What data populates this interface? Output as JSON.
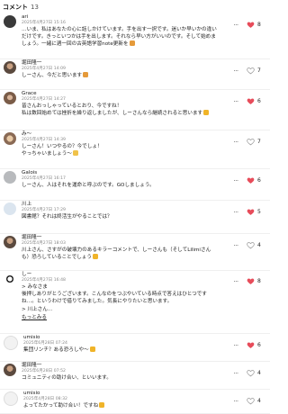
{
  "header": {
    "title": "コメント",
    "count": "13"
  },
  "colors": {
    "liked": "#e74c5a",
    "unliked": "#999999"
  },
  "comments": [
    {
      "author": "ari",
      "date": "2025年4月27日 15:16",
      "text": "…いま、私はあなたの心に話しかけています。手を出す一択です。迷いか早いかの違いだけです。きっといつかは手を出します。それなら早い方がいいのです。そして始めましょう。一緒に週一回の古英語学習note更新を",
      "emoji": "book",
      "likes": "8",
      "liked": true
    },
    {
      "author": "堀田隆一",
      "date": "2025年4月27日 14:09",
      "text": "しーさん、今だと思います",
      "emoji": "book",
      "likes": "7",
      "liked": false
    },
    {
      "author": "Grace",
      "date": "2025年4月27日 14:27",
      "text": "皆さんおっしゃっているとおり、今ですね！\n私は数回始めては挫折を繰り返しましたが、しーさんなら継続されると思います",
      "emoji": "smile",
      "likes": "6",
      "liked": true
    },
    {
      "author": "み〜",
      "date": "2025年4月27日 14:39",
      "text": "しーさん！いつやるの？今でしょ！\nやっちゃいましょう〜",
      "emoji": "hands",
      "likes": "7",
      "liked": false
    },
    {
      "author": "Galois",
      "date": "2025年4月27日 16:17",
      "text": "しーさん、人はそれを運命と呼ぶのです。GOしましょう。",
      "emoji": "",
      "likes": "6",
      "liked": true
    },
    {
      "author": "川上",
      "date": "2025年4月27日 17:29",
      "text": "図書館？それは終活生がやることでは？",
      "emoji": "",
      "likes": "5",
      "liked": true
    },
    {
      "author": "堀田隆一",
      "date": "2025年4月27日 18:03",
      "text": "川上さん、さすがの破壊力のあるキラーコメントで、しーさんも（そしてLilimiさんも）恐ろしていることでしょう",
      "emoji": "smile",
      "likes": "4",
      "liked": false
    },
    {
      "author": "しー",
      "date": "2025年4月27日 16:48",
      "text": "> みなさま\n後押しありがとうございます。こんなのをつぶやいている時点で答えはひとつですね…。というわけで借りてみました。気長にやりたいと思います。\n> 川上さん…",
      "emoji": "",
      "more": "もっとみる",
      "likes": "8",
      "liked": true
    },
    {
      "author": "umisio",
      "date": "2025年6月28日 07:24",
      "text": "集団リンチ？ある恐ろしや〜",
      "emoji": "smile",
      "likes": "6",
      "liked": true
    },
    {
      "author": "堀田隆一",
      "date": "2025年6月28日 07:52",
      "text": "コミュニティの助け合い、といいます。",
      "emoji": "",
      "likes": "4",
      "liked": false
    },
    {
      "author": "umisio",
      "date": "2025年4月28日 08:32",
      "text": "よってたかって助け合い！ですね",
      "emoji": "smile",
      "likes": "4",
      "liked": false
    }
  ]
}
